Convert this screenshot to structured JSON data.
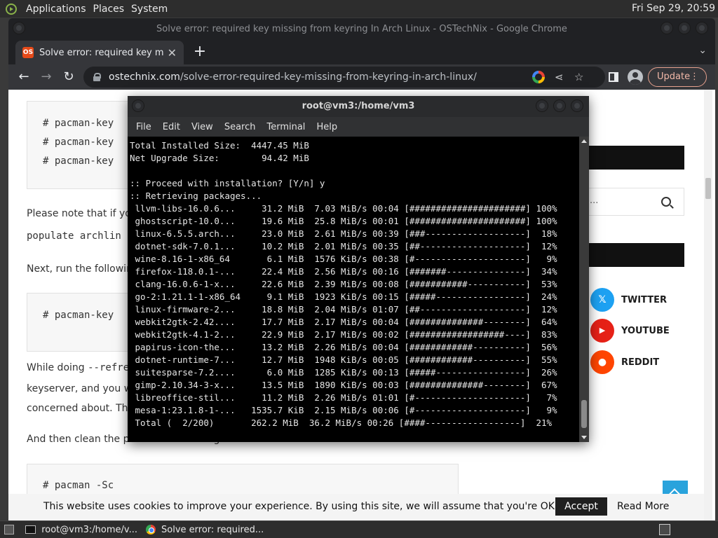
{
  "top_panel": {
    "menus": [
      "Applications",
      "Places",
      "System"
    ],
    "clock": "Fri Sep 29, 20:59"
  },
  "chrome": {
    "window_title": "Solve error: required key missing from keyring In Arch Linux - OSTechNix - Google Chrome",
    "tab_title": "Solve error: required key missi",
    "tab_favicon_text": "OS",
    "url_host": "ostechnix.com",
    "url_path": "/solve-error-required-key-missing-from-keyring-in-arch-linux/",
    "update_label": "Update"
  },
  "webpage": {
    "code_block_1": [
      "# pacman-key",
      "# pacman-key",
      "# pacman-key"
    ],
    "para_note": "Please note that if yo",
    "para_populate": "populate archlin",
    "para_next": "Next, run the followin",
    "code_block_2": [
      "# pacman-key"
    ],
    "para_while_prefix": "While doing ",
    "para_while_code": "--refre",
    "para_keyserver": "keyserver, and you w",
    "para_concerned": "concerned about. Th",
    "para_clean": "And then clean the p",
    "para_clean_tail": "g",
    "code_block_3": [
      "# pacman -Sc"
    ],
    "sidebar_search_dots": "...",
    "social": [
      {
        "label": "TWITTER",
        "icon": "𝕏",
        "color": "#1da1f2"
      },
      {
        "label": "YOUTUBE",
        "icon": "▶",
        "color": "#e62117"
      },
      {
        "label": "REDDIT",
        "icon": "●",
        "color": "#ff4500"
      }
    ],
    "cookie_text": "This website uses cookies to improve your experience. By using this site, we will assume that you're OK with it.",
    "accept_label": "Accept",
    "read_more_label": "Read More"
  },
  "terminal": {
    "title": "root@vm3:/home/vm3",
    "menu": [
      "File",
      "Edit",
      "View",
      "Search",
      "Terminal",
      "Help"
    ],
    "lines": [
      "Total Installed Size:  4447.45 MiB",
      "Net Upgrade Size:        94.42 MiB",
      "",
      ":: Proceed with installation? [Y/n] y",
      ":: Retrieving packages...",
      " llvm-libs-16.0.6...     31.2 MiB  7.03 MiB/s 00:04 [######################] 100%",
      " ghostscript-10.0...     19.6 MiB  25.8 MiB/s 00:01 [######################] 100%",
      " linux-6.5.5.arch...     23.0 MiB  2.61 MiB/s 00:39 [###-------------------]  18%",
      " dotnet-sdk-7.0.1...     10.2 MiB  2.01 MiB/s 00:35 [##--------------------]  12%",
      " wine-8.16-1-x86_64       6.1 MiB  1576 KiB/s 00:38 [#---------------------]   9%",
      " firefox-118.0.1-...     22.4 MiB  2.56 MiB/s 00:16 [#######---------------]  34%",
      " clang-16.0.6-1-x...     22.6 MiB  2.39 MiB/s 00:08 [###########-----------]  53%",
      " go-2:1.21.1-1-x86_64     9.1 MiB  1923 KiB/s 00:15 [#####-----------------]  24%",
      " linux-firmware-2...     18.8 MiB  2.04 MiB/s 01:07 [##--------------------]  12%",
      " webkit2gtk-2.42....     17.7 MiB  2.17 MiB/s 00:04 [##############--------]  64%",
      " webkit2gtk-4.1-2...     22.9 MiB  2.17 MiB/s 00:02 [##################----]  83%",
      " papirus-icon-the...     13.2 MiB  2.26 MiB/s 00:04 [############----------]  56%",
      " dotnet-runtime-7...     12.7 MiB  1948 KiB/s 00:05 [############----------]  55%",
      " suitesparse-7.2....      6.0 MiB  1285 KiB/s 00:13 [#####-----------------]  26%",
      " gimp-2.10.34-3-x...     13.5 MiB  1890 KiB/s 00:03 [##############--------]  67%",
      " libreoffice-stil...     11.2 MiB  2.26 MiB/s 01:01 [#---------------------]   7%",
      " mesa-1:23.1.8-1-...   1535.7 KiB  2.15 MiB/s 00:06 [#---------------------]   9%",
      " Total (  2/200)       262.2 MiB  36.2 MiB/s 00:26 [####------------------]  21%"
    ]
  },
  "taskbar": {
    "tasks": [
      "root@vm3:/home/v...",
      "Solve error: required..."
    ]
  }
}
